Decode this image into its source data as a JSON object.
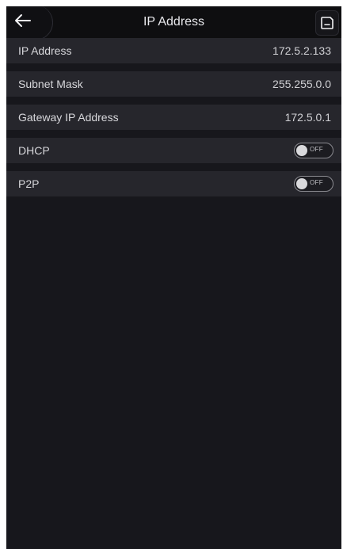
{
  "header": {
    "title": "IP Address",
    "back_icon": "arrow-left-icon",
    "save_icon": "save-icon"
  },
  "settings": [
    {
      "label": "IP Address",
      "value": "172.5.2.133"
    },
    {
      "label": "Subnet Mask",
      "value": "255.255.0.0"
    },
    {
      "label": "Gateway IP Address",
      "value": "172.5.0.1"
    },
    {
      "label": "DHCP",
      "toggle": "OFF"
    },
    {
      "label": "P2P",
      "toggle": "OFF"
    }
  ],
  "colors": {
    "background": "#17171c",
    "row_background": "#26262c",
    "header_background": "#0e0e10"
  }
}
